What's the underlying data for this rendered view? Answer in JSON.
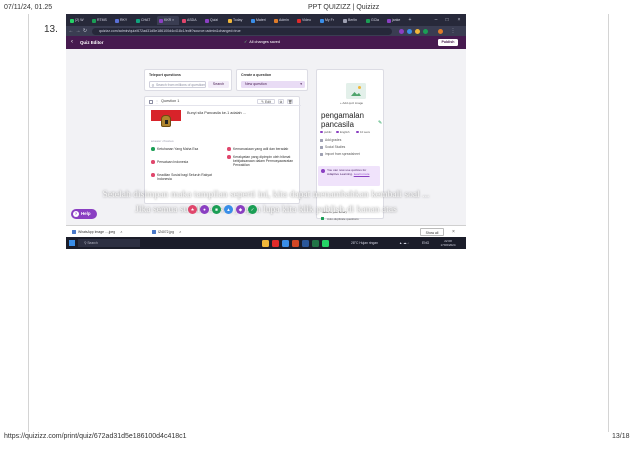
{
  "print_header": {
    "datetime": "07/11/24, 01.25",
    "title": "PPT QUIZIZZ | Quizizz"
  },
  "print_footer": {
    "url": "https://quizizz.com/print/quiz/672ad31d5e186100d4c418c1",
    "page": "13/18"
  },
  "question_number": "13.",
  "browser": {
    "tabs": [
      {
        "label": "(2) W",
        "color": "#25d366"
      },
      {
        "label": "RTMS",
        "color": "#1b9e55"
      },
      {
        "label": "RKY",
        "color": "#5a6fd6"
      },
      {
        "label": "CHAT",
        "color": "#10a37f"
      },
      {
        "label": "KKR ×",
        "color": "#8a3fc2",
        "active": true
      },
      {
        "label": "ASDA",
        "color": "#e0466c"
      },
      {
        "label": "Quizi",
        "color": "#8a3fc2"
      },
      {
        "label": "Today",
        "color": "#f1b73a"
      },
      {
        "label": "Materi",
        "color": "#3a8ee8"
      },
      {
        "label": "Admin",
        "color": "#e07c2a"
      },
      {
        "label": "Video",
        "color": "#e02a2a"
      },
      {
        "label": "My Fr",
        "color": "#3a8ee8"
      },
      {
        "label": "Berlin",
        "color": "#9ea0b2"
      },
      {
        "label": "GCla",
        "color": "#1b9e55"
      },
      {
        "label": "janke",
        "color": "#8a3fc2"
      }
    ],
    "url": "quizizz.com/admin/quiz/672ad31d5e186100d4c418c1/edit?source=admin&changed=true"
  },
  "editor": {
    "title": "Quiz Editor",
    "save_status": "All changes saved",
    "publish_label": "Publish",
    "teleport": {
      "label": "Teleport questions",
      "search_placeholder": "Search from millions of questions",
      "search_button": "Search"
    },
    "create": {
      "label": "Create a question",
      "new_question_button": "New question"
    },
    "question": {
      "title": "Question 1",
      "edit_label": "Edit",
      "text": "Bunyi sila Pancasila ke-1 adalah ...",
      "answers_label": "answer choices",
      "options": [
        {
          "text": "Ketuhanan Yang Maha Esa",
          "color": "#1b9e55"
        },
        {
          "text": "Kemanusiaan yang adil dan beradab",
          "color": "#e0466c"
        },
        {
          "text": "Persatuan Indonesia",
          "color": "#e0466c"
        },
        {
          "text": "Kerakyatan yang dipimpin oleh hikmat kebijaksanaan dalam Permusyawaratan Perwakilan",
          "color": "#e0466c"
        },
        {
          "text": "Keadilan Sosial bagi Seluruh Rakyat Indonesia",
          "color": "#e0466c"
        }
      ]
    },
    "sidebar": {
      "add_image": "Add quiz image",
      "quiz_name": "pengamalan pancasila",
      "meta": [
        "public",
        "English",
        "10 secs"
      ],
      "items": [
        "Add grades",
        "Social Studies",
        "Import from spreadsheet"
      ],
      "adaptive_text": "You can now use quizzes for Adaptive Learning.",
      "adaptive_link": "Learn more",
      "save_to_library": "Save to your library",
      "duplicate_label": "Auto-duplicate questions"
    }
  },
  "overlay": {
    "line1": "Setelah disimpan maka tampilan seperti ini, kita dapat menambahkan kembali soal ...",
    "line2": "Jika semua sudah selesai, jangan lupa kita klik publish di kanan atas"
  },
  "help_label": "Help",
  "downloads": [
    {
      "name": "WhatsApp Image ....jpeg"
    },
    {
      "name": "IZ4072.jpg"
    }
  ],
  "show_all_label": "Show all",
  "taskbar": {
    "search_placeholder": "Search",
    "weather": "28°C  Hujan ringan",
    "lang": "ENG",
    "time": "22:08",
    "date": "17/06/2024"
  }
}
